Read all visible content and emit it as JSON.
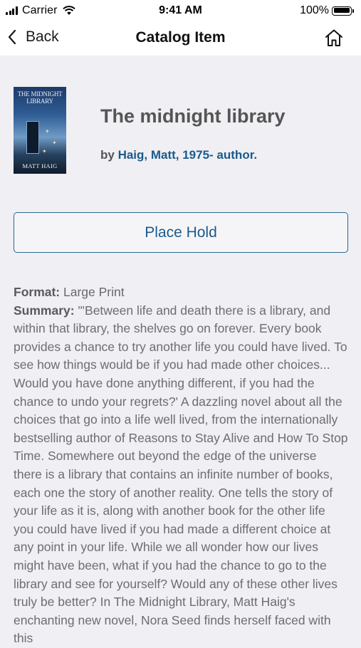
{
  "status_bar": {
    "carrier": "Carrier",
    "time": "9:41 AM",
    "battery_percent": "100%",
    "battery_level": 1.0,
    "signal_icon": "cellular-signal-icon",
    "wifi_icon": "wifi-icon",
    "battery_icon": "battery-icon"
  },
  "nav": {
    "back_label": "Back",
    "back_icon": "chevron-left-icon",
    "title": "Catalog Item",
    "home_icon": "home-icon"
  },
  "book": {
    "cover": {
      "title": "THE MIDNIGHT LIBRARY",
      "author": "MATT HAIG"
    },
    "title": "The midnight library",
    "by_prefix": "by ",
    "author": "Haig, Matt, 1975- author."
  },
  "actions": {
    "place_hold_label": "Place Hold"
  },
  "details": {
    "format_label": "Format:",
    "format_value": "Large Print",
    "summary_label": "Summary:",
    "summary_value": "\"'Between life and death there is a library, and within that library, the shelves go on forever. Every book provides a chance to try another life you could have lived. To see how things would be if you had made other choices... Would you have done anything different, if you had the chance to undo your regrets?' A dazzling novel about all the choices that go into a life well lived, from the internationally bestselling author of Reasons to Stay Alive and How To Stop Time. Somewhere out beyond the edge of the universe there is a library that contains an infinite number of books, each one the story of another reality. One tells the story of your life as it is, along with another book for the other life you could have lived if you had made a different choice at any point in your life. While we all wonder how our lives might have been, what if you had the chance to go to the library and see for yourself? Would any of these other lives truly be better? In The Midnight Library, Matt Haig's enchanting new novel, Nora Seed finds herself faced with this"
  },
  "colors": {
    "background": "#efeff4",
    "accent": "#1c5a8a",
    "header_bg": "#ffffff"
  }
}
